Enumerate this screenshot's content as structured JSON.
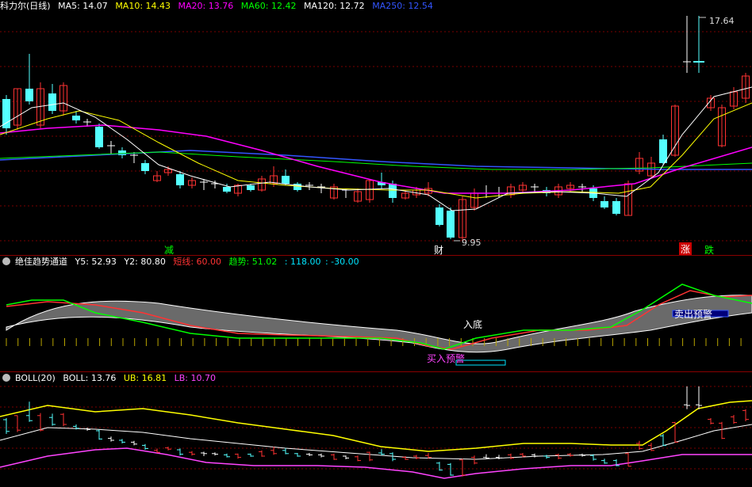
{
  "main": {
    "title": "科力尔(日线)",
    "ma": [
      {
        "label": "MA5: 14.07",
        "color": "#ffffff"
      },
      {
        "label": "MA10: 14.43",
        "color": "#ffff00"
      },
      {
        "label": "MA20: 13.76",
        "color": "#ff00ff"
      },
      {
        "label": "MA60: 12.42",
        "color": "#00ff00"
      },
      {
        "label": "MA120: 12.72",
        "color": "#ffffff"
      },
      {
        "label": "MA250: 12.54",
        "color": "#3355ff"
      }
    ],
    "high_label": "17.64",
    "low_label": "9.95",
    "signals": [
      {
        "text": "减",
        "color": "#00ff00"
      },
      {
        "text": "财",
        "color": "#ffffff"
      },
      {
        "text": "涨",
        "color": "#ffffff",
        "bg": "#cc0000"
      },
      {
        "text": "跌",
        "color": "#00ff00"
      }
    ]
  },
  "trend": {
    "title": "绝佳趋势通道",
    "y5": "Y5: 52.93",
    "y2": "Y2: 80.80",
    "short": "短线: 60.00",
    "trend": "趋势: 51.02",
    "v1": ": 118.00",
    "v2": ": -30.00",
    "colors": {
      "short": "#ff3333",
      "trend": "#00ff00",
      "v": "#00e5ff"
    },
    "label_bottom": "入底",
    "label_buy": "买入预警",
    "label_sell": "卖出预警"
  },
  "boll": {
    "title": "BOLL(20)",
    "boll": "BOLL: 13.76",
    "ub": "UB: 16.81",
    "lb": "LB: 10.70",
    "colors": {
      "ub": "#ffff00",
      "lb": "#ff44ff"
    }
  }
}
